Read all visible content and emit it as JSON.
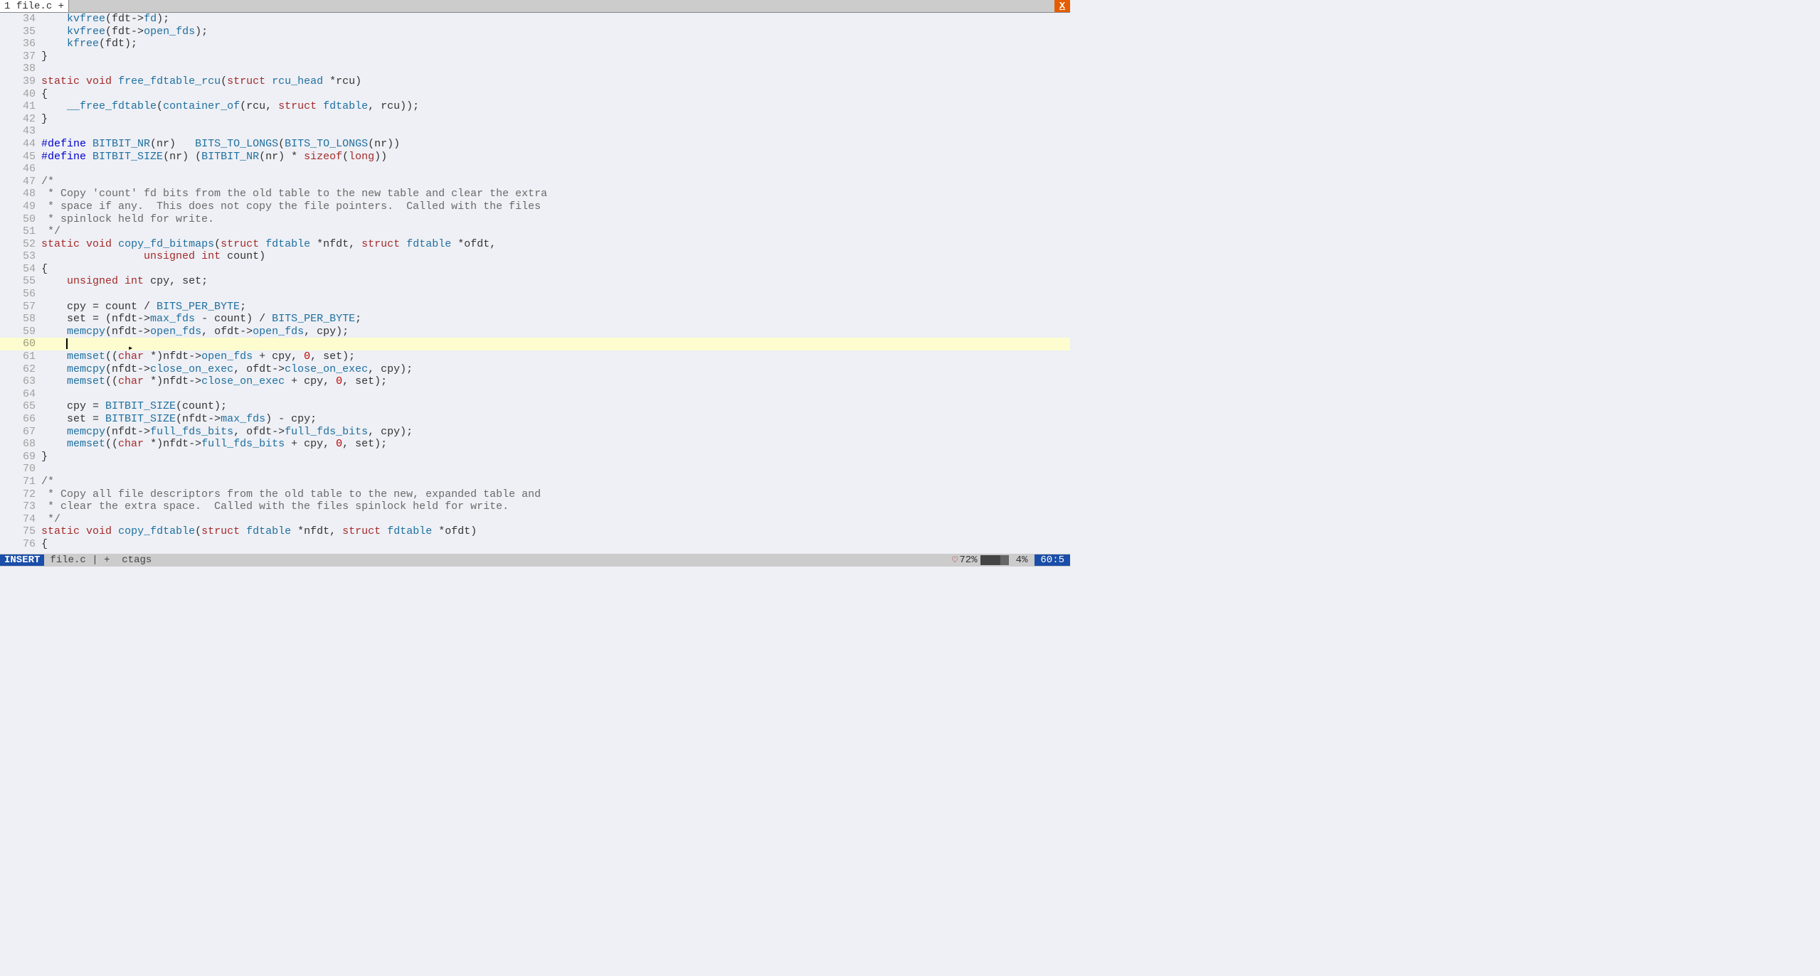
{
  "tab": {
    "index": "1",
    "name": "file.c",
    "mod": "+"
  },
  "close_label": "X",
  "status": {
    "mode": "INSERT",
    "file": "file.c",
    "sep": "|",
    "mod": "+",
    "tag": "ctags",
    "heart": "♡",
    "batt": "72%",
    "scroll": "4%",
    "pos": "60:5"
  },
  "current_line": 60,
  "cursor_col_prefix": "    ",
  "lines": [
    {
      "n": 34,
      "t": [
        [
          "    ",
          ""
        ],
        [
          "kvfree",
          "fn"
        ],
        [
          "(fdt",
          ""
        ],
        [
          "->",
          ""
        ],
        [
          "fd",
          "id"
        ],
        [
          ");",
          ""
        ]
      ]
    },
    {
      "n": 35,
      "t": [
        [
          "    ",
          ""
        ],
        [
          "kvfree",
          "fn"
        ],
        [
          "(fdt",
          ""
        ],
        [
          "->",
          ""
        ],
        [
          "open_fds",
          "id"
        ],
        [
          ");",
          ""
        ]
      ]
    },
    {
      "n": 36,
      "t": [
        [
          "    ",
          ""
        ],
        [
          "kfree",
          "fn"
        ],
        [
          "(fdt);",
          ""
        ]
      ]
    },
    {
      "n": 37,
      "t": [
        [
          "}",
          ""
        ]
      ]
    },
    {
      "n": 38,
      "t": [
        [
          "",
          ""
        ]
      ]
    },
    {
      "n": 39,
      "t": [
        [
          "static",
          "type"
        ],
        [
          " ",
          ""
        ],
        [
          "void",
          "type"
        ],
        [
          " ",
          ""
        ],
        [
          "free_fdtable_rcu",
          "fn"
        ],
        [
          "(",
          ""
        ],
        [
          "struct",
          "type"
        ],
        [
          " ",
          ""
        ],
        [
          "rcu_head",
          "id"
        ],
        [
          " *rcu)",
          ""
        ]
      ]
    },
    {
      "n": 40,
      "t": [
        [
          "{",
          ""
        ]
      ]
    },
    {
      "n": 41,
      "t": [
        [
          "    ",
          ""
        ],
        [
          "__free_fdtable",
          "fn"
        ],
        [
          "(",
          ""
        ],
        [
          "container_of",
          "fn"
        ],
        [
          "(rcu, ",
          ""
        ],
        [
          "struct",
          "type"
        ],
        [
          " ",
          ""
        ],
        [
          "fdtable",
          "id"
        ],
        [
          ", rcu));",
          ""
        ]
      ]
    },
    {
      "n": 42,
      "t": [
        [
          "}",
          ""
        ]
      ]
    },
    {
      "n": 43,
      "t": [
        [
          "",
          ""
        ]
      ]
    },
    {
      "n": 44,
      "t": [
        [
          "#define",
          "def"
        ],
        [
          " ",
          ""
        ],
        [
          "BITBIT_NR",
          "id"
        ],
        [
          "(nr)   ",
          ""
        ],
        [
          "BITS_TO_LONGS",
          "id"
        ],
        [
          "(",
          ""
        ],
        [
          "BITS_TO_LONGS",
          "id"
        ],
        [
          "(nr))",
          ""
        ]
      ]
    },
    {
      "n": 45,
      "t": [
        [
          "#define",
          "def"
        ],
        [
          " ",
          ""
        ],
        [
          "BITBIT_SIZE",
          "id"
        ],
        [
          "(nr) (",
          ""
        ],
        [
          "BITBIT_NR",
          "id"
        ],
        [
          "(nr) * ",
          ""
        ],
        [
          "sizeof",
          "kw"
        ],
        [
          "(",
          ""
        ],
        [
          "long",
          "type"
        ],
        [
          "))",
          ""
        ]
      ]
    },
    {
      "n": 46,
      "t": [
        [
          "",
          ""
        ]
      ]
    },
    {
      "n": 47,
      "t": [
        [
          "/*",
          "cmt"
        ]
      ]
    },
    {
      "n": 48,
      "t": [
        [
          " * Copy 'count' fd bits from the old table to the new table and clear the extra",
          "cmt"
        ]
      ]
    },
    {
      "n": 49,
      "t": [
        [
          " * space if any.  This does not copy the file pointers.  Called with the files",
          "cmt"
        ]
      ]
    },
    {
      "n": 50,
      "t": [
        [
          " * spinlock held for write.",
          "cmt"
        ]
      ]
    },
    {
      "n": 51,
      "t": [
        [
          " */",
          "cmt"
        ]
      ]
    },
    {
      "n": 52,
      "t": [
        [
          "static",
          "type"
        ],
        [
          " ",
          ""
        ],
        [
          "void",
          "type"
        ],
        [
          " ",
          ""
        ],
        [
          "copy_fd_bitmaps",
          "fn"
        ],
        [
          "(",
          ""
        ],
        [
          "struct",
          "type"
        ],
        [
          " ",
          ""
        ],
        [
          "fdtable",
          "id"
        ],
        [
          " *nfdt, ",
          ""
        ],
        [
          "struct",
          "type"
        ],
        [
          " ",
          ""
        ],
        [
          "fdtable",
          "id"
        ],
        [
          " *ofdt,",
          ""
        ]
      ]
    },
    {
      "n": 53,
      "t": [
        [
          "                ",
          ""
        ],
        [
          "unsigned",
          "type"
        ],
        [
          " ",
          ""
        ],
        [
          "int",
          "type"
        ],
        [
          " count)",
          ""
        ]
      ]
    },
    {
      "n": 54,
      "t": [
        [
          "{",
          ""
        ]
      ]
    },
    {
      "n": 55,
      "t": [
        [
          "    ",
          ""
        ],
        [
          "unsigned",
          "type"
        ],
        [
          " ",
          ""
        ],
        [
          "int",
          "type"
        ],
        [
          " cpy, set;",
          ""
        ]
      ]
    },
    {
      "n": 56,
      "t": [
        [
          "",
          ""
        ]
      ]
    },
    {
      "n": 57,
      "t": [
        [
          "    cpy = count / ",
          ""
        ],
        [
          "BITS_PER_BYTE",
          "id"
        ],
        [
          ";",
          ""
        ]
      ]
    },
    {
      "n": 58,
      "t": [
        [
          "    set = (nfdt",
          ""
        ],
        [
          "->",
          ""
        ],
        [
          "max_fds",
          "id"
        ],
        [
          " - count) / ",
          ""
        ],
        [
          "BITS_PER_BYTE",
          "id"
        ],
        [
          ";",
          ""
        ]
      ]
    },
    {
      "n": 59,
      "t": [
        [
          "    ",
          ""
        ],
        [
          "memcpy",
          "fn"
        ],
        [
          "(nfdt",
          ""
        ],
        [
          "->",
          ""
        ],
        [
          "open_fds",
          "id"
        ],
        [
          ", ofdt",
          ""
        ],
        [
          "->",
          ""
        ],
        [
          "open_fds",
          "id"
        ],
        [
          ", cpy);",
          ""
        ]
      ]
    },
    {
      "n": 60,
      "t": [
        [
          "",
          ""
        ]
      ]
    },
    {
      "n": 61,
      "t": [
        [
          "    ",
          ""
        ],
        [
          "memset",
          "fn"
        ],
        [
          "((",
          ""
        ],
        [
          "char",
          "type"
        ],
        [
          " *)nfdt",
          ""
        ],
        [
          "->",
          ""
        ],
        [
          "open_fds",
          "id"
        ],
        [
          " + cpy, ",
          ""
        ],
        [
          "0",
          "num"
        ],
        [
          ", set);",
          ""
        ]
      ]
    },
    {
      "n": 62,
      "t": [
        [
          "    ",
          ""
        ],
        [
          "memcpy",
          "fn"
        ],
        [
          "(nfdt",
          ""
        ],
        [
          "->",
          ""
        ],
        [
          "close_on_exec",
          "id"
        ],
        [
          ", ofdt",
          ""
        ],
        [
          "->",
          ""
        ],
        [
          "close_on_exec",
          "id"
        ],
        [
          ", cpy);",
          ""
        ]
      ]
    },
    {
      "n": 63,
      "t": [
        [
          "    ",
          ""
        ],
        [
          "memset",
          "fn"
        ],
        [
          "((",
          ""
        ],
        [
          "char",
          "type"
        ],
        [
          " *)nfdt",
          ""
        ],
        [
          "->",
          ""
        ],
        [
          "close_on_exec",
          "id"
        ],
        [
          " + cpy, ",
          ""
        ],
        [
          "0",
          "num"
        ],
        [
          ", set);",
          ""
        ]
      ]
    },
    {
      "n": 64,
      "t": [
        [
          "",
          ""
        ]
      ]
    },
    {
      "n": 65,
      "t": [
        [
          "    cpy = ",
          ""
        ],
        [
          "BITBIT_SIZE",
          "id"
        ],
        [
          "(count);",
          ""
        ]
      ]
    },
    {
      "n": 66,
      "t": [
        [
          "    set = ",
          ""
        ],
        [
          "BITBIT_SIZE",
          "id"
        ],
        [
          "(nfdt",
          ""
        ],
        [
          "->",
          ""
        ],
        [
          "max_fds",
          "id"
        ],
        [
          ") - cpy;",
          ""
        ]
      ]
    },
    {
      "n": 67,
      "t": [
        [
          "    ",
          ""
        ],
        [
          "memcpy",
          "fn"
        ],
        [
          "(nfdt",
          ""
        ],
        [
          "->",
          ""
        ],
        [
          "full_fds_bits",
          "id"
        ],
        [
          ", ofdt",
          ""
        ],
        [
          "->",
          ""
        ],
        [
          "full_fds_bits",
          "id"
        ],
        [
          ", cpy);",
          ""
        ]
      ]
    },
    {
      "n": 68,
      "t": [
        [
          "    ",
          ""
        ],
        [
          "memset",
          "fn"
        ],
        [
          "((",
          ""
        ],
        [
          "char",
          "type"
        ],
        [
          " *)nfdt",
          ""
        ],
        [
          "->",
          ""
        ],
        [
          "full_fds_bits",
          "id"
        ],
        [
          " + cpy, ",
          ""
        ],
        [
          "0",
          "num"
        ],
        [
          ", set);",
          ""
        ]
      ]
    },
    {
      "n": 69,
      "t": [
        [
          "}",
          ""
        ]
      ]
    },
    {
      "n": 70,
      "t": [
        [
          "",
          ""
        ]
      ]
    },
    {
      "n": 71,
      "t": [
        [
          "/*",
          "cmt"
        ]
      ]
    },
    {
      "n": 72,
      "t": [
        [
          " * Copy all file descriptors from the old table to the new, expanded table and",
          "cmt"
        ]
      ]
    },
    {
      "n": 73,
      "t": [
        [
          " * clear the extra space.  Called with the files spinlock held for write.",
          "cmt"
        ]
      ]
    },
    {
      "n": 74,
      "t": [
        [
          " */",
          "cmt"
        ]
      ]
    },
    {
      "n": 75,
      "t": [
        [
          "static",
          "type"
        ],
        [
          " ",
          ""
        ],
        [
          "void",
          "type"
        ],
        [
          " ",
          ""
        ],
        [
          "copy_fdtable",
          "fn"
        ],
        [
          "(",
          ""
        ],
        [
          "struct",
          "type"
        ],
        [
          " ",
          ""
        ],
        [
          "fdtable",
          "id"
        ],
        [
          " *nfdt, ",
          ""
        ],
        [
          "struct",
          "type"
        ],
        [
          " ",
          ""
        ],
        [
          "fdtable",
          "id"
        ],
        [
          " *ofdt)",
          ""
        ]
      ]
    },
    {
      "n": 76,
      "t": [
        [
          "{",
          ""
        ]
      ]
    }
  ]
}
